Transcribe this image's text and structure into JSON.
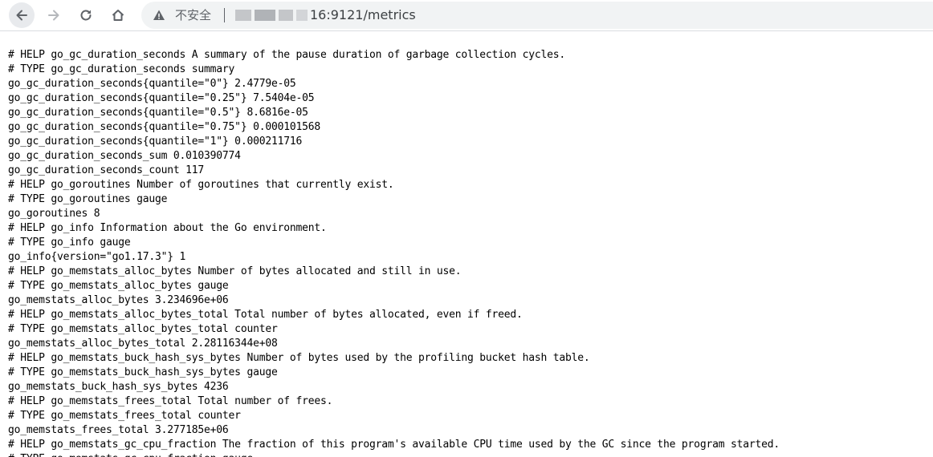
{
  "browser": {
    "security_label": "不安全",
    "url_visible": "16:9121/metrics"
  },
  "metrics_lines": [
    "# HELP go_gc_duration_seconds A summary of the pause duration of garbage collection cycles.",
    "# TYPE go_gc_duration_seconds summary",
    "go_gc_duration_seconds{quantile=\"0\"} 2.4779e-05",
    "go_gc_duration_seconds{quantile=\"0.25\"} 7.5404e-05",
    "go_gc_duration_seconds{quantile=\"0.5\"} 8.6816e-05",
    "go_gc_duration_seconds{quantile=\"0.75\"} 0.000101568",
    "go_gc_duration_seconds{quantile=\"1\"} 0.000211716",
    "go_gc_duration_seconds_sum 0.010390774",
    "go_gc_duration_seconds_count 117",
    "# HELP go_goroutines Number of goroutines that currently exist.",
    "# TYPE go_goroutines gauge",
    "go_goroutines 8",
    "# HELP go_info Information about the Go environment.",
    "# TYPE go_info gauge",
    "go_info{version=\"go1.17.3\"} 1",
    "# HELP go_memstats_alloc_bytes Number of bytes allocated and still in use.",
    "# TYPE go_memstats_alloc_bytes gauge",
    "go_memstats_alloc_bytes 3.234696e+06",
    "# HELP go_memstats_alloc_bytes_total Total number of bytes allocated, even if freed.",
    "# TYPE go_memstats_alloc_bytes_total counter",
    "go_memstats_alloc_bytes_total 2.28116344e+08",
    "# HELP go_memstats_buck_hash_sys_bytes Number of bytes used by the profiling bucket hash table.",
    "# TYPE go_memstats_buck_hash_sys_bytes gauge",
    "go_memstats_buck_hash_sys_bytes 4236",
    "# HELP go_memstats_frees_total Total number of frees.",
    "# TYPE go_memstats_frees_total counter",
    "go_memstats_frees_total 3.277185e+06",
    "# HELP go_memstats_gc_cpu_fraction The fraction of this program's available CPU time used by the GC since the program started.",
    "# TYPE go_memstats_gc_cpu_fraction gauge"
  ]
}
